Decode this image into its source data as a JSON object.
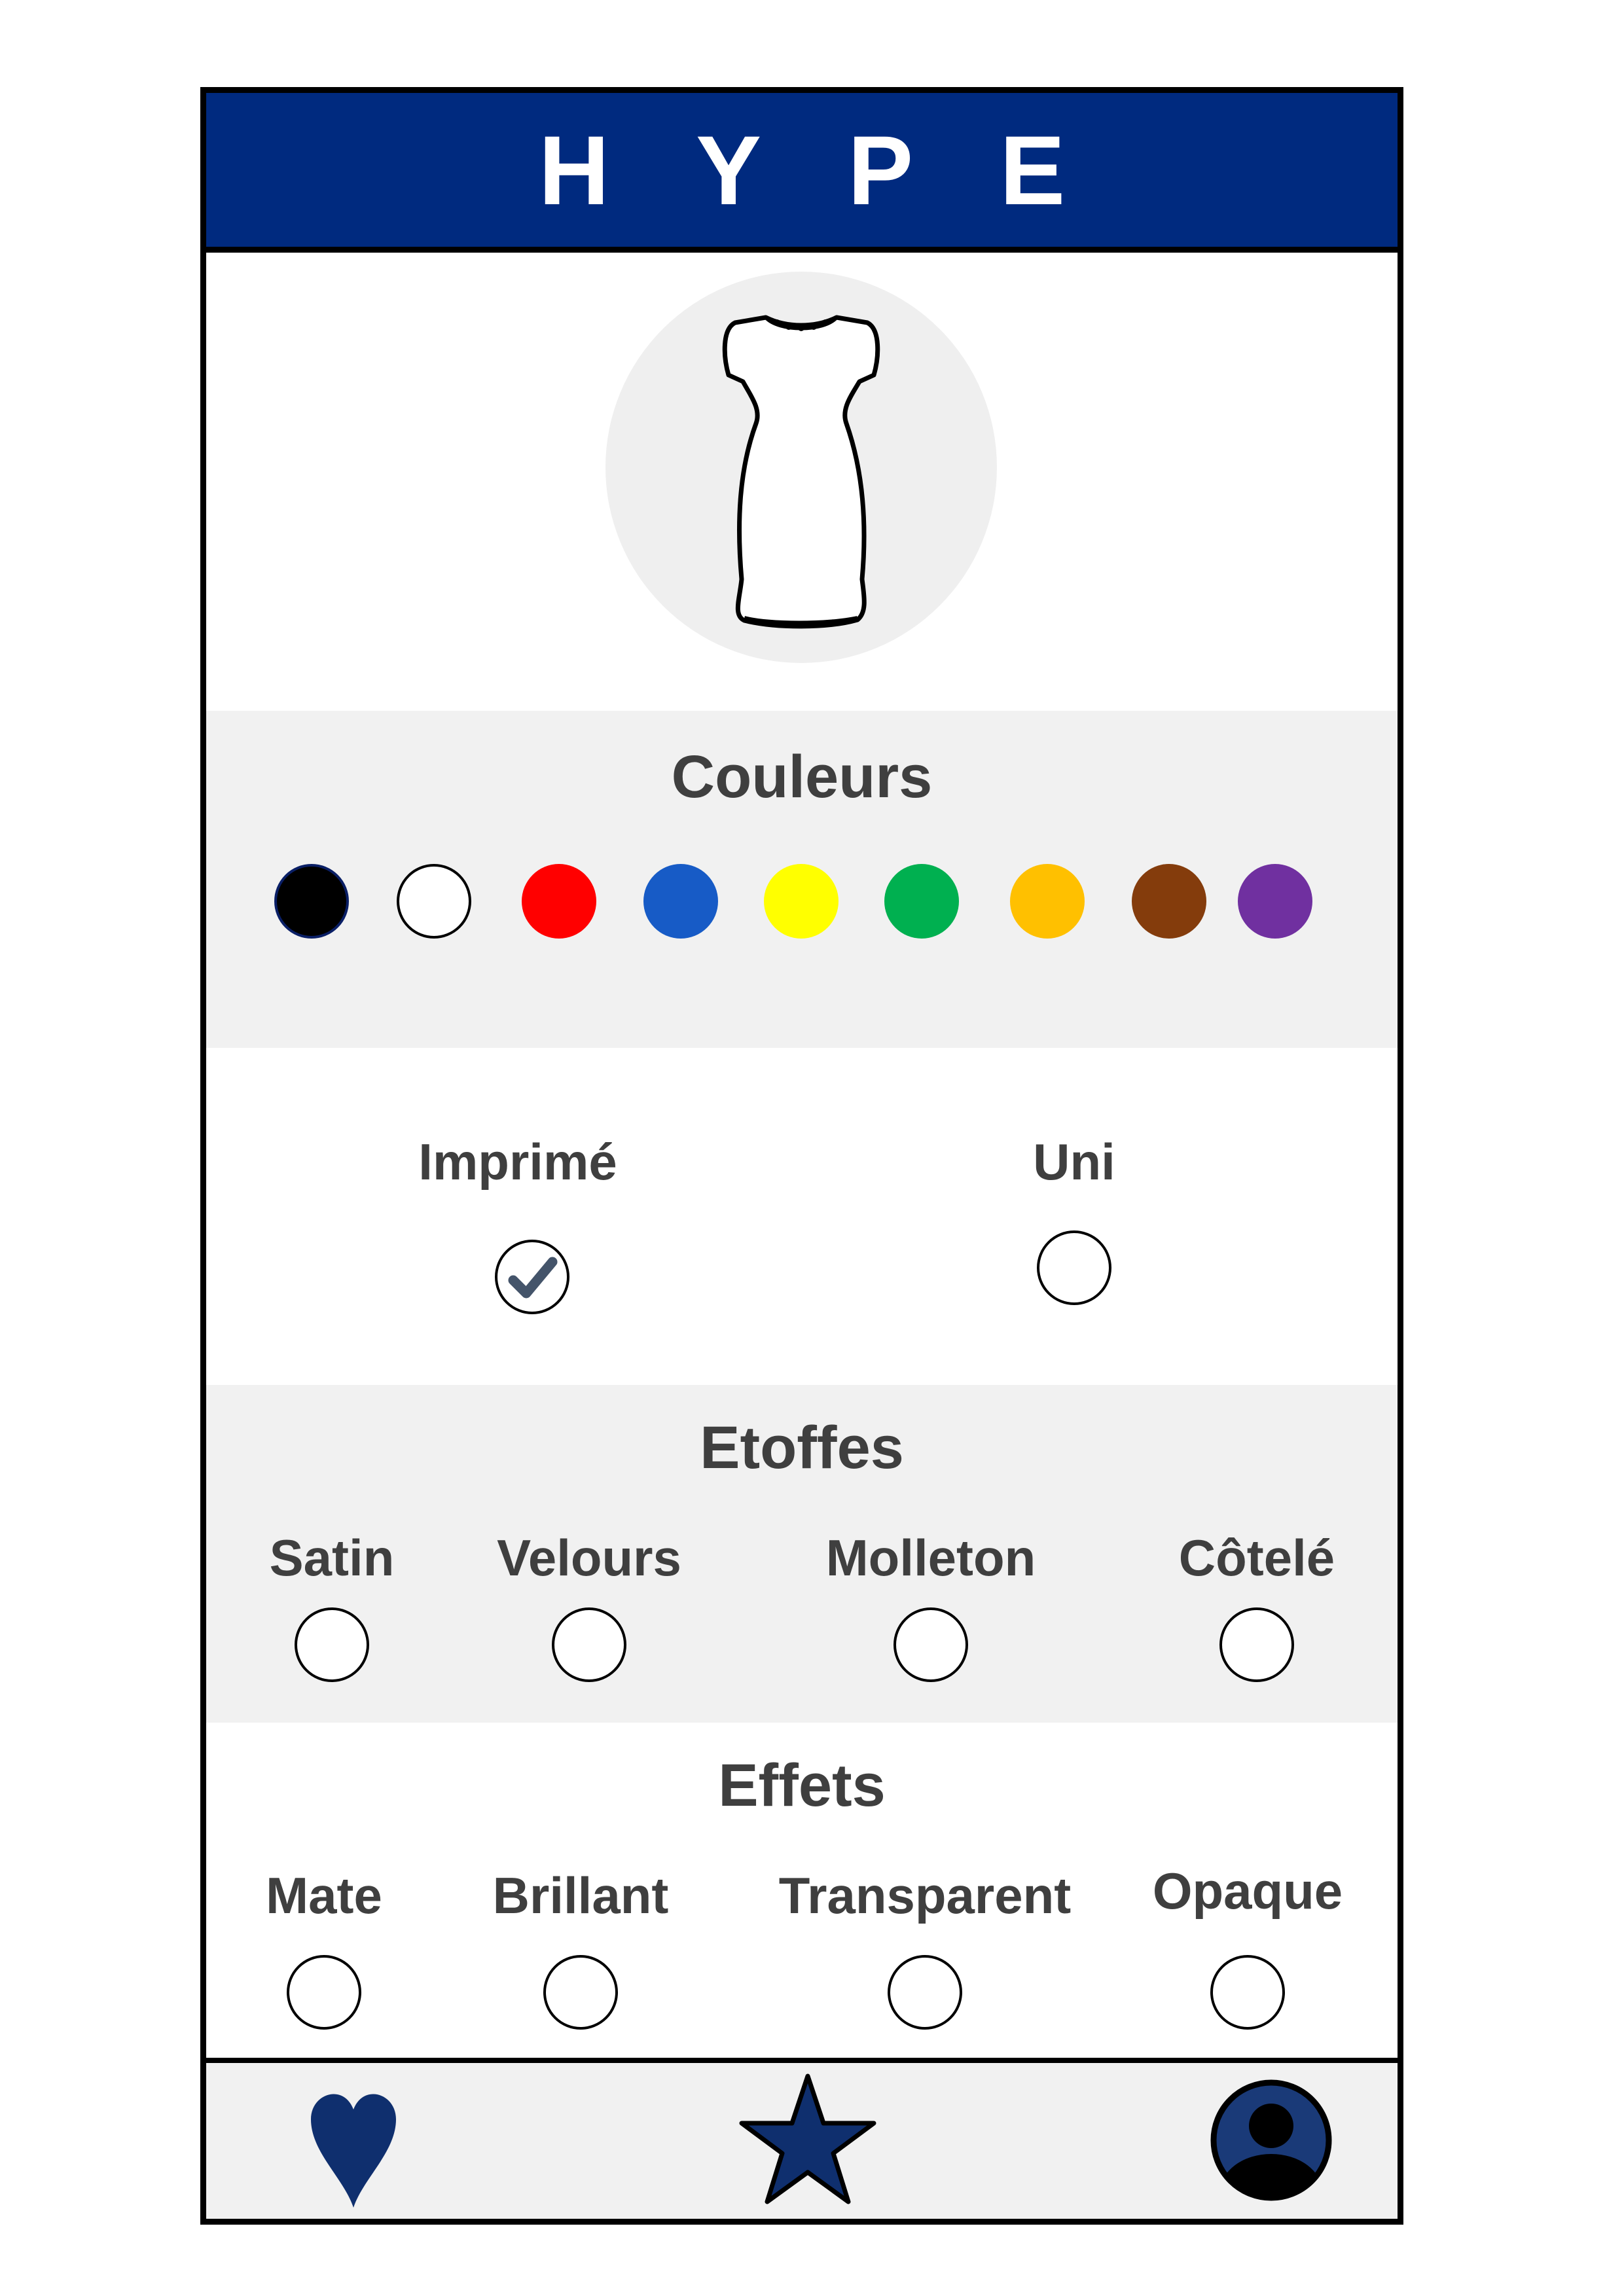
{
  "app": {
    "brand": "HYPE"
  },
  "colors": {
    "title": "Couleurs",
    "swatches": [
      {
        "name": "black",
        "hex": "#000000"
      },
      {
        "name": "white",
        "hex": "#ffffff"
      },
      {
        "name": "red",
        "hex": "#ff0000"
      },
      {
        "name": "blue",
        "hex": "#175bc6"
      },
      {
        "name": "yellow",
        "hex": "#ffff00"
      },
      {
        "name": "green",
        "hex": "#00b050"
      },
      {
        "name": "orange",
        "hex": "#ffc000"
      },
      {
        "name": "brown",
        "hex": "#843c0c"
      },
      {
        "name": "purple",
        "hex": "#7030a0"
      }
    ],
    "selected": "black"
  },
  "pattern": {
    "options": [
      {
        "label": "Imprimé",
        "checked": true
      },
      {
        "label": "Uni",
        "checked": false
      }
    ]
  },
  "fabrics": {
    "title": "Etoffes",
    "options": [
      {
        "label": "Satin",
        "checked": false
      },
      {
        "label": "Velours",
        "checked": false
      },
      {
        "label": "Molleton",
        "checked": false
      },
      {
        "label": "Côtelé",
        "checked": false
      }
    ]
  },
  "effects": {
    "title": "Effets",
    "options": [
      {
        "label": "Mate",
        "checked": false
      },
      {
        "label": "Brillant",
        "checked": false
      },
      {
        "label": "Transparent",
        "checked": false
      },
      {
        "label": "Opaque",
        "checked": false
      }
    ]
  },
  "nav": {
    "items": [
      {
        "icon": "heart-icon"
      },
      {
        "icon": "star-icon"
      },
      {
        "icon": "profile-icon"
      }
    ]
  },
  "theme": {
    "primary": "#002a7f",
    "nav_icon": "#0f2f6e",
    "section_gray": "#f1f1f1"
  }
}
